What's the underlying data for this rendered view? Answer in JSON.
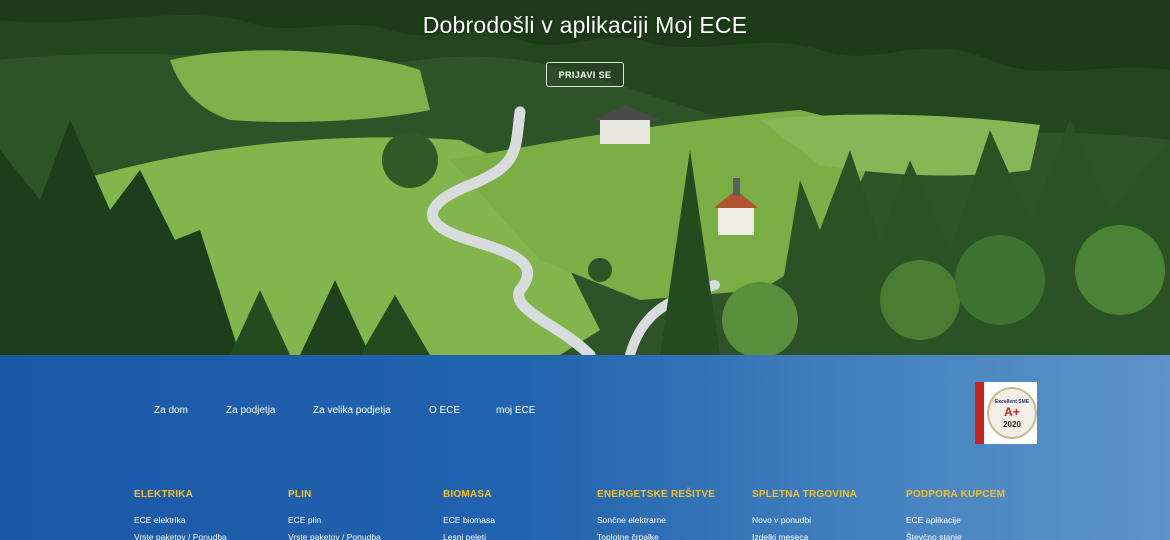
{
  "hero": {
    "title": "Dobrodošli v aplikaciji Moj ECE",
    "login_label": "PRIJAVI SE"
  },
  "main_nav": [
    {
      "label": "Za dom"
    },
    {
      "label": "Za podjetja"
    },
    {
      "label": "Za velika podjetja"
    },
    {
      "label": "O ECE"
    },
    {
      "label": "moj ECE"
    }
  ],
  "badge": {
    "brand": "Excellent SME",
    "grade": "A+",
    "year": "2020"
  },
  "footer_columns": [
    {
      "heading": "ELEKTRIKA",
      "links": [
        "ECE elektrika",
        "Vrste paketov / Ponudba"
      ]
    },
    {
      "heading": "PLIN",
      "links": [
        "ECE plin",
        "Vrste paketov / Ponudba"
      ]
    },
    {
      "heading": "BIOMASA",
      "links": [
        "ECE biomasa",
        "Lesni peleti"
      ]
    },
    {
      "heading": "ENERGETSKE REŠITVE",
      "links": [
        "Sončne elektrarne",
        "Toplotne črpalke"
      ]
    },
    {
      "heading": "SPLETNA TRGOVINA",
      "links": [
        "Novo v ponudbi",
        "Izdelki meseca"
      ]
    },
    {
      "heading": "PODPORA KUPCEM",
      "links": [
        "ECE aplikacije",
        "Števčno stanje"
      ]
    }
  ],
  "colors": {
    "footer_blue": "#1d5ba6",
    "heading_yellow": "#f2c02d",
    "badge_red": "#c8221f"
  }
}
